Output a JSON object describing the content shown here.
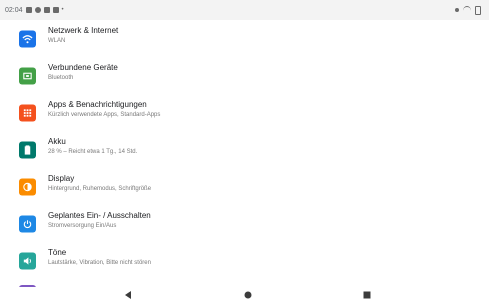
{
  "status_bar": {
    "time": "02:04"
  },
  "settings": [
    {
      "title": "Netzwerk & Internet",
      "subtitle": "WLAN",
      "color": "#1a73e8",
      "icon": "wifi-icon"
    },
    {
      "title": "Verbundene Geräte",
      "subtitle": "Bluetooth",
      "color": "#43a047",
      "icon": "devices-icon"
    },
    {
      "title": "Apps & Benachrichtigungen",
      "subtitle": "Kürzlich verwendete Apps, Standard-Apps",
      "color": "#f4511e",
      "icon": "apps-icon"
    },
    {
      "title": "Akku",
      "subtitle": "28 % – Reicht etwa 1 Tg., 14 Std.",
      "color": "#00796b",
      "icon": "battery-icon"
    },
    {
      "title": "Display",
      "subtitle": "Hintergrund, Ruhemodus, Schriftgröße",
      "color": "#fb8c00",
      "icon": "display-icon"
    },
    {
      "title": "Geplantes Ein- / Ausschalten",
      "subtitle": "Stromversorgung Ein/Aus",
      "color": "#1e88e5",
      "icon": "power-icon"
    },
    {
      "title": "Töne",
      "subtitle": "Lautstärke, Vibration, Bitte nicht stören",
      "color": "#26a69a",
      "icon": "sound-icon"
    }
  ]
}
